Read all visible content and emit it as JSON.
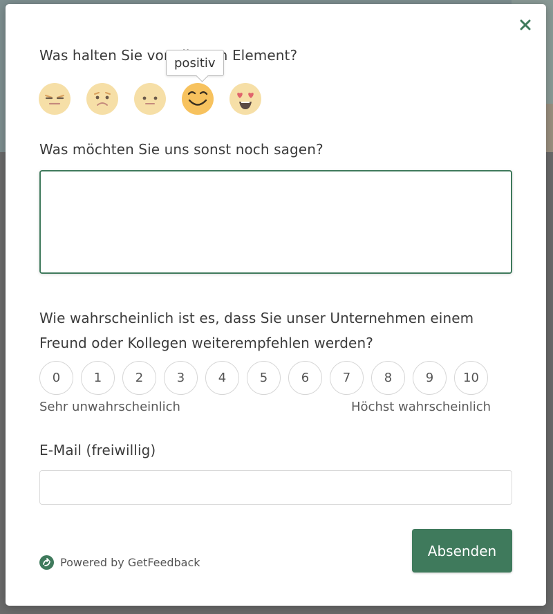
{
  "modal": {
    "close_label": "×",
    "question_rating": "Was halten Sie von diesem Element?",
    "rating_options": [
      {
        "name": "sehr negativ",
        "icon": "angry-face-icon"
      },
      {
        "name": "negativ",
        "icon": "sad-face-icon"
      },
      {
        "name": "neutral",
        "icon": "neutral-face-icon"
      },
      {
        "name": "positiv",
        "icon": "smiling-face-icon"
      },
      {
        "name": "sehr positiv",
        "icon": "heart-eyes-face-icon"
      }
    ],
    "tooltip": "positiv",
    "question_comment": "Was möchten Sie uns sonst noch sagen?",
    "comment_value": "",
    "question_nps": "Wie wahrscheinlich ist es, dass Sie unser Unternehmen einem Freund oder Kollegen weiterempfehlen werden?",
    "nps_scale": [
      "0",
      "1",
      "2",
      "3",
      "4",
      "5",
      "6",
      "7",
      "8",
      "9",
      "10"
    ],
    "nps_low_label": "Sehr unwahrscheinlich",
    "nps_high_label": "Höchst wahrscheinlich",
    "question_email": "E-Mail (freiwillig)",
    "email_value": "",
    "submit_label": "Absenden",
    "powered_by": "Powered by GetFeedback"
  },
  "colors": {
    "accent": "#3f7a5c",
    "emoji_inactive": "#f6dfa7",
    "emoji_active": "#f7c25e"
  }
}
